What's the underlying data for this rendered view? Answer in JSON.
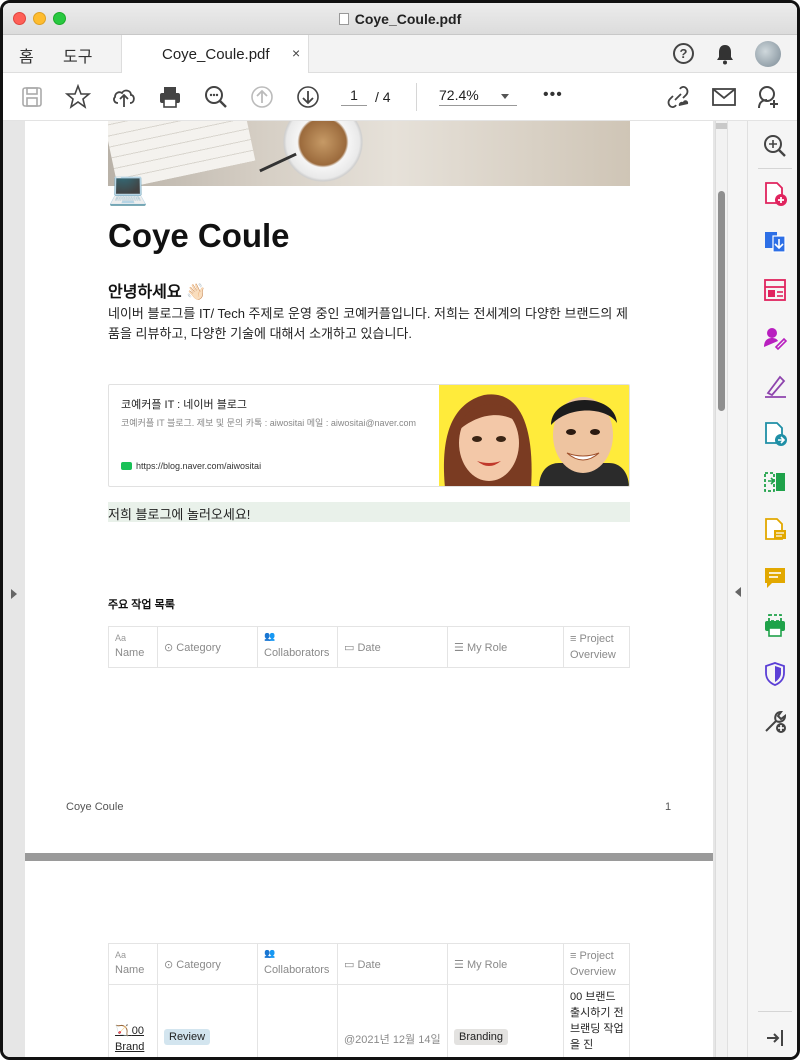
{
  "window": {
    "title": "Coye_Coule.pdf"
  },
  "tabs": {
    "home_label": "홈",
    "tools_label": "도구",
    "doc_tab_label": "Coye_Coule.pdf",
    "close_glyph": "×"
  },
  "header": {
    "help_glyph": "?"
  },
  "toolbar": {
    "page_current": "1",
    "page_total": "/ 4",
    "zoom": "72.4%",
    "more_glyph": "•••"
  },
  "document": {
    "page_emoji": "💻",
    "title": "Coye Coule",
    "greeting": "안녕하세요 👋🏻",
    "intro": "네이버 블로그를 IT/ Tech 주제로 운영 중인 코예커플입니다. 저희는 전세계의 다양한 브랜드의 제품을 리뷰하고, 다양한 기술에 대해서 소개하고 있습니다.",
    "bookmark": {
      "title": "코예커플 IT : 네이버 블로그",
      "description": "코예커플 IT 블로그.  제보 및 문의 카톡 : aiwositai 메일 : aiwositai@naver.com",
      "url": "https://blog.naver.com/aiwositai"
    },
    "callout": "저희 블로그에 놀러오세요!",
    "section_heading": "주요 작업 목록",
    "table": {
      "columns": [
        {
          "icon": "Aa",
          "label": "Name"
        },
        {
          "icon": "⊙",
          "label": "Category"
        },
        {
          "icon": "👥",
          "label": "Collaborators"
        },
        {
          "icon": "▭",
          "label": "Date"
        },
        {
          "icon": "☰",
          "label": "My Role"
        },
        {
          "icon": "≡",
          "label": "Project Overview"
        }
      ],
      "rows": [
        {
          "emoji": "🏹",
          "name": "00 Brand",
          "category": "Review",
          "collaborators": "",
          "date": "@2021년 12월 14일",
          "role": "Branding",
          "overview": "00 브랜드 출시하기 전 브랜딩 작업을 진"
        }
      ]
    },
    "footer_left": "Coye Coule",
    "footer_right": "1"
  },
  "colors": {
    "accent_red": "#e0245e",
    "accent_blue": "#2d6fe6",
    "accent_purple": "#8e44ad",
    "accent_green": "#1fa24a",
    "accent_yellow": "#e2a800"
  }
}
